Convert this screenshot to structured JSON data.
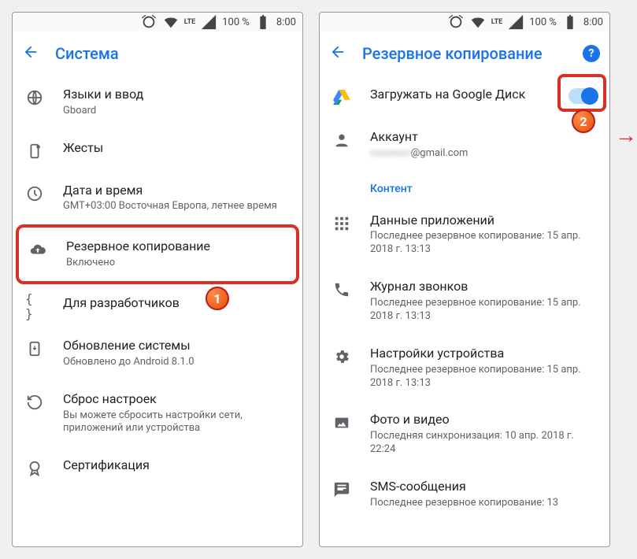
{
  "status": {
    "battery": "100 %",
    "time": "8:00",
    "network": "LTE"
  },
  "left": {
    "title": "Система",
    "items": [
      {
        "id": "languages",
        "title": "Языки и ввод",
        "sub": "Gboard"
      },
      {
        "id": "gestures",
        "title": "Жесты",
        "sub": ""
      },
      {
        "id": "datetime",
        "title": "Дата и время",
        "sub": "GMT+03:00 Восточная Европа, летнее время"
      },
      {
        "id": "backup",
        "title": "Резервное копирование",
        "sub": "Включено"
      },
      {
        "id": "developer",
        "title": "Для разработчиков",
        "sub": ""
      },
      {
        "id": "update",
        "title": "Обновление системы",
        "sub": "Обновлено до Android 8.1.0"
      },
      {
        "id": "reset",
        "title": "Сброс настроек",
        "sub": "Вы можете сбросить настройки сети, приложений или устройства"
      },
      {
        "id": "cert",
        "title": "Сертификация",
        "sub": ""
      }
    ]
  },
  "right": {
    "title": "Резервное копирование",
    "drive_label": "Загружать на Google Диск",
    "account_label": "Аккаунт",
    "account_value": "@gmail.com",
    "section": "Контент",
    "items": [
      {
        "id": "apps",
        "title": "Данные приложений",
        "sub": "Последнее резервное копирование: 15 апр. 2018 г. 13:13"
      },
      {
        "id": "calls",
        "title": "Журнал звонков",
        "sub": "Последнее резервное копирование: 15 апр. 2018 г. 13:13"
      },
      {
        "id": "device",
        "title": "Настройки устройства",
        "sub": "Последнее резервное копирование: 15 апр. 2018 г. 13:13"
      },
      {
        "id": "media",
        "title": "Фото и видео",
        "sub": "Последняя синхронизация: 10 апр. 2018 г. 22:24"
      },
      {
        "id": "sms",
        "title": "SMS-сообщения",
        "sub": "Последнее резервное копирование: 13"
      }
    ]
  },
  "badges": {
    "one": "1",
    "two": "2"
  }
}
